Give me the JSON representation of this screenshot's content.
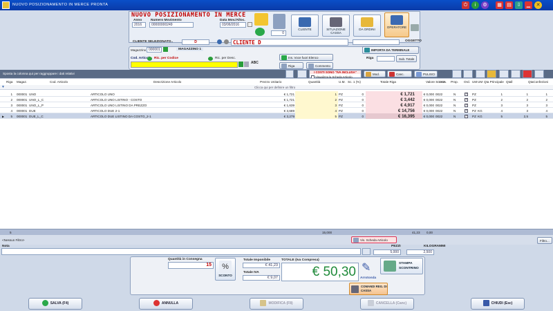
{
  "window": {
    "title": "NUOVO POSIZIONAMENTO IN  MERCE PRONTA"
  },
  "header": {
    "title": "NUOVO POSIZIONAMENTO IN  MERCE",
    "anno_label": "Anno",
    "anno_value": "2016",
    "numero_label": "Numero Movimento",
    "numero_value": "00000000249",
    "data_label": "Data Mov./Alloc.",
    "data_value": "03/06/2016",
    "counter_value": "0",
    "cliente_btn": "CLIENTE",
    "situazione_btn": "SITUAZIONE CASSA",
    "ordini_btn": "DA ORDINI",
    "operatore_btn": "OPERATORE",
    "oggetto_label": "OGGETTO"
  },
  "customer": {
    "label": "CLIENTE SELEZIONATO..",
    "code": "D",
    "name": "CLIENTE D"
  },
  "article_bar": {
    "magazzino_label": "Magazzino",
    "magazzino_code": "000001",
    "magazzino_name": "MAGAZZINO 1",
    "cod_articolo_label": "Cod. Articolo",
    "ric_codice": "Ric. per Codice",
    "ric_desc": "Ric. per Desc.",
    "ins_voce": "Ins. Voce fuori Elenco",
    "importa": "IMPORTA DA TERMINALE",
    "riga_label": "Riga",
    "sub_totale": "Sub. Totale",
    "riga_vuota": "Riga Vuota",
    "commento": "Commento",
    "abc": "ABC"
  },
  "toolbar": {
    "group_hint": "Sposta la colonna qui per raggruppare i dati relativi",
    "iva_banner": "I COSTI SONO \"IVA INCLUSA\"",
    "usa_scheda": "Visualizza la Scheda Articolo",
    "mod_riga": "Mod. Riga",
    "canc_riga": "Canc. Riga",
    "pulisci": "PULISCI"
  },
  "grid": {
    "filter_hint": "Clicca qui per definire un filtro",
    "columns": [
      "Riga",
      "Magaz.",
      "Cod. Articolo",
      "Descrizione Articolo",
      "Prezzo Unitario",
      "Quantità",
      "U.M.",
      "Sc. 1 (%)",
      "Totale Riga",
      "Valore Sconto",
      "I.V.A.",
      "Prop.",
      "Ord.",
      "UM",
      "UM",
      "Qta Principale",
      "Qtall",
      "QtaConfezioni"
    ],
    "rows": [
      {
        "riga": "1",
        "mag": "000001",
        "cod": "UNO",
        "desc": "ARTICOLO UNO",
        "prezzo": "€ 1,721",
        "qta": "1",
        "um": "PZ",
        "sc": "0",
        "tot": "€ 1,721",
        "vsc": "€ 0,000",
        "iva": "0022",
        "prop": "N",
        "um1": "PZ",
        "um2": "",
        "qp": "1",
        "qtall": "1",
        "qc": "1"
      },
      {
        "riga": "2",
        "mag": "000001",
        "cod": "UNO_L_C",
        "desc": "ARTICOLO UNO LISTINO - COSTO",
        "prezzo": "€ 1,721",
        "qta": "2",
        "um": "PZ",
        "sc": "0",
        "tot": "€ 3,442",
        "vsc": "€ 0,000",
        "iva": "0022",
        "prop": "N",
        "um1": "PZ",
        "um2": "",
        "qp": "2",
        "qtall": "2",
        "qc": "2"
      },
      {
        "riga": "3",
        "mag": "000001",
        "cod": "UNO_L_P",
        "desc": "ARTICOLO UNO LISTINO DA PREZZO",
        "prezzo": "€ 1,639",
        "qta": "3",
        "um": "PZ",
        "sc": "0",
        "tot": "€ 4,917",
        "vsc": "€ 0,000",
        "iva": "0022",
        "prop": "N",
        "um1": "PZ",
        "um2": "",
        "qp": "3",
        "qtall": "3",
        "qc": "3"
      },
      {
        "riga": "4",
        "mag": "000001",
        "cod": "DUE",
        "desc": "ARTICOLO DUE 2-1",
        "prezzo": "€ 3,689",
        "qta": "4",
        "um": "PZ",
        "sc": "0",
        "tot": "€ 14,756",
        "vsc": "€ 0,000",
        "iva": "0022",
        "prop": "N",
        "um1": "PZ",
        "um2": "KG",
        "qp": "4",
        "qtall": "3",
        "qc": "4"
      },
      {
        "riga": "5",
        "mag": "000001",
        "cod": "DUE_L_C",
        "desc": "ARTICOLO DUE LISTINO DA COSTO_2-1",
        "prezzo": "€ 3,279",
        "qta": "5",
        "um": "PZ",
        "sc": "0",
        "tot": "€ 16,395",
        "vsc": "€ 0,000",
        "iva": "0022",
        "prop": "N",
        "um1": "PZ",
        "um2": "KG",
        "qp": "5",
        "qtall": "2,5",
        "qc": "5"
      }
    ],
    "summary": {
      "count": "5",
      "qta": "15,000",
      "total": "41,23",
      "vsc": "0,00"
    }
  },
  "statusbar": {
    "nessun_filtro": "<Nessun Filtro>",
    "vis_scheda": "Vis. Scheda Articolo",
    "filtro": "Filtro..."
  },
  "nota": {
    "label": "Nota",
    "pezzi_label": "PEZZI",
    "pezzi_value": "5,000",
    "kg_label": "KILOGRAMMI",
    "kg_value": "2,500"
  },
  "totals": {
    "qta_consegna_label": "Quantità in Consegna",
    "qta_consegna": "15",
    "sconto_btn": "SCONTO",
    "imponibile_label": "Totale Imponibile",
    "imponibile": "€ 41,23",
    "iva_label": "Totale IVA",
    "iva": "€ 9,07",
    "totale_label": "TOTALE (Iva Compresa)",
    "totale": "€ 50,30",
    "arrotonda": "Arrotonda",
    "stampa": "STAMPA SCONTRINO",
    "comandi": "COMANDI REG. DI CASSA"
  },
  "footer": {
    "salva": "SALVA (F4)",
    "annulla": "ANNULLA",
    "modifica": "MODIFICA (F8)",
    "cancella": "CANCELLA (Canc)",
    "chiudi": "CHIUDI (Esc)"
  },
  "colors": {
    "accent": "#0a4fc8",
    "danger": "#c00000",
    "total_bg": "#fbdfe3",
    "qty_bg": "#fff8cf"
  }
}
